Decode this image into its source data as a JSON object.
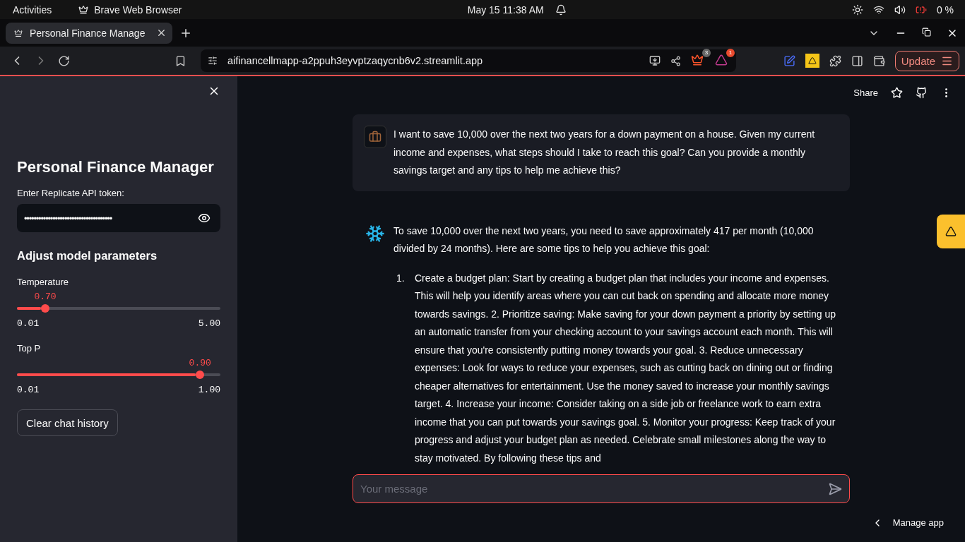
{
  "system_bar": {
    "activities": "Activities",
    "app_name": "Brave Web Browser",
    "datetime": "May 15  11:38 AM",
    "battery": "0 %"
  },
  "browser": {
    "tabs": [
      {
        "title": "Personal Finance Manage",
        "selected": true
      }
    ],
    "url": "aifinancellmapp-a2ppuh3eyvptzaqycnb6v2.streamlit.app",
    "shields_count": "3",
    "rewards_count": "1",
    "update_button": "Update"
  },
  "sidebar": {
    "title": "Personal Finance Manager",
    "token_label": "Enter Replicate API token:",
    "token_value": "•••••••••••••••••••••••••••••••••••••",
    "section_title": "Adjust model parameters",
    "sliders": [
      {
        "label": "Temperature",
        "value": "0.70",
        "min": "0.01",
        "max": "5.00",
        "level": 0.139
      },
      {
        "label": "Top P",
        "value": "0.90",
        "min": "0.01",
        "max": "1.00",
        "level": 0.9
      }
    ],
    "clear_button": "Clear chat history"
  },
  "header": {
    "share": "Share"
  },
  "messages": [
    {
      "kind": "user",
      "text": "I want to save 10,000 over the next two years for a down payment on a house. Given my current income and expenses, what steps should I take to reach this goal? Can you provide a monthly savings target and any tips to help me achieve this?"
    },
    {
      "kind": "assistant",
      "text": "To save 10,000 over the next two years, you need to save approximately 417 per month (10,000 divided by 24 months). Here are some tips to help you achieve this goal:",
      "list": [
        {
          "number": "1.",
          "text": "Create a budget plan: Start by creating a budget plan that includes your income and expenses. This will help you identify areas where you can cut back on spending and allocate more money towards savings. 2. Prioritize saving: Make saving for your down payment a priority by setting up an automatic transfer from your checking account to your savings account each month. This will ensure that you're consistently putting money towards your goal. 3. Reduce unnecessary expenses: Look for ways to reduce your expenses, such as cutting back on dining out or finding cheaper alternatives for entertainment. Use the money saved to increase your monthly savings target. 4. Increase your income: Consider taking on a side job or freelance work to earn extra income that you can put towards your savings goal. 5. Monitor your progress: Keep track of your progress and adjust your budget plan as needed. Celebrate small milestones along the way to stay motivated. By following these tips and"
        }
      ]
    }
  ],
  "chat_input": {
    "placeholder": "Your message"
  },
  "footer": {
    "manage_app": "Manage app"
  }
}
